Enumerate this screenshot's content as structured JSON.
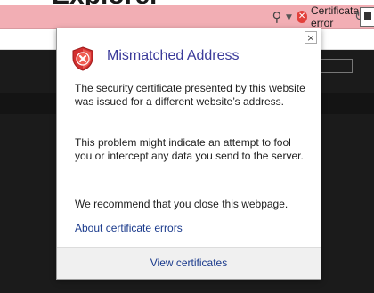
{
  "header": {
    "title": "Explorer"
  },
  "address_bar": {
    "search_icon": "search-icon",
    "dropdown_icon": "chevron-down-icon",
    "certificate_error_label": "Certificate error",
    "certificate_error_icon": "error-x-icon",
    "refresh_icon": "refresh-icon",
    "bar_color": "#f2aeb4"
  },
  "popup": {
    "title": "Mismatched Address",
    "shield_icon": "shield-error-icon",
    "close_label": "×",
    "paragraphs": [
      "The security certificate presented by this website was issued for a different website’s address.",
      "This problem might indicate an attempt to fool you or intercept any data you send to the server.",
      "We recommend that you close this webpage."
    ],
    "link_label": "About certificate errors",
    "footer_button": "View certificates",
    "title_color": "#3a3a9a",
    "link_color": "#1a3a8c"
  }
}
